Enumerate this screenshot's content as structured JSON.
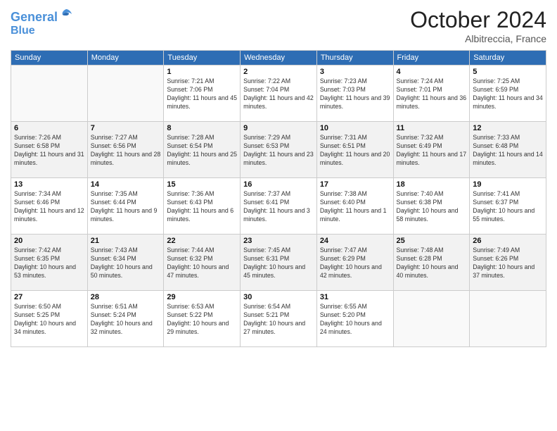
{
  "header": {
    "logo_line1": "General",
    "logo_line2": "Blue",
    "month": "October 2024",
    "location": "Albitreccia, France"
  },
  "weekdays": [
    "Sunday",
    "Monday",
    "Tuesday",
    "Wednesday",
    "Thursday",
    "Friday",
    "Saturday"
  ],
  "weeks": [
    [
      {
        "day": "",
        "info": ""
      },
      {
        "day": "",
        "info": ""
      },
      {
        "day": "1",
        "info": "Sunrise: 7:21 AM\nSunset: 7:06 PM\nDaylight: 11 hours and 45 minutes."
      },
      {
        "day": "2",
        "info": "Sunrise: 7:22 AM\nSunset: 7:04 PM\nDaylight: 11 hours and 42 minutes."
      },
      {
        "day": "3",
        "info": "Sunrise: 7:23 AM\nSunset: 7:03 PM\nDaylight: 11 hours and 39 minutes."
      },
      {
        "day": "4",
        "info": "Sunrise: 7:24 AM\nSunset: 7:01 PM\nDaylight: 11 hours and 36 minutes."
      },
      {
        "day": "5",
        "info": "Sunrise: 7:25 AM\nSunset: 6:59 PM\nDaylight: 11 hours and 34 minutes."
      }
    ],
    [
      {
        "day": "6",
        "info": "Sunrise: 7:26 AM\nSunset: 6:58 PM\nDaylight: 11 hours and 31 minutes."
      },
      {
        "day": "7",
        "info": "Sunrise: 7:27 AM\nSunset: 6:56 PM\nDaylight: 11 hours and 28 minutes."
      },
      {
        "day": "8",
        "info": "Sunrise: 7:28 AM\nSunset: 6:54 PM\nDaylight: 11 hours and 25 minutes."
      },
      {
        "day": "9",
        "info": "Sunrise: 7:29 AM\nSunset: 6:53 PM\nDaylight: 11 hours and 23 minutes."
      },
      {
        "day": "10",
        "info": "Sunrise: 7:31 AM\nSunset: 6:51 PM\nDaylight: 11 hours and 20 minutes."
      },
      {
        "day": "11",
        "info": "Sunrise: 7:32 AM\nSunset: 6:49 PM\nDaylight: 11 hours and 17 minutes."
      },
      {
        "day": "12",
        "info": "Sunrise: 7:33 AM\nSunset: 6:48 PM\nDaylight: 11 hours and 14 minutes."
      }
    ],
    [
      {
        "day": "13",
        "info": "Sunrise: 7:34 AM\nSunset: 6:46 PM\nDaylight: 11 hours and 12 minutes."
      },
      {
        "day": "14",
        "info": "Sunrise: 7:35 AM\nSunset: 6:44 PM\nDaylight: 11 hours and 9 minutes."
      },
      {
        "day": "15",
        "info": "Sunrise: 7:36 AM\nSunset: 6:43 PM\nDaylight: 11 hours and 6 minutes."
      },
      {
        "day": "16",
        "info": "Sunrise: 7:37 AM\nSunset: 6:41 PM\nDaylight: 11 hours and 3 minutes."
      },
      {
        "day": "17",
        "info": "Sunrise: 7:38 AM\nSunset: 6:40 PM\nDaylight: 11 hours and 1 minute."
      },
      {
        "day": "18",
        "info": "Sunrise: 7:40 AM\nSunset: 6:38 PM\nDaylight: 10 hours and 58 minutes."
      },
      {
        "day": "19",
        "info": "Sunrise: 7:41 AM\nSunset: 6:37 PM\nDaylight: 10 hours and 55 minutes."
      }
    ],
    [
      {
        "day": "20",
        "info": "Sunrise: 7:42 AM\nSunset: 6:35 PM\nDaylight: 10 hours and 53 minutes."
      },
      {
        "day": "21",
        "info": "Sunrise: 7:43 AM\nSunset: 6:34 PM\nDaylight: 10 hours and 50 minutes."
      },
      {
        "day": "22",
        "info": "Sunrise: 7:44 AM\nSunset: 6:32 PM\nDaylight: 10 hours and 47 minutes."
      },
      {
        "day": "23",
        "info": "Sunrise: 7:45 AM\nSunset: 6:31 PM\nDaylight: 10 hours and 45 minutes."
      },
      {
        "day": "24",
        "info": "Sunrise: 7:47 AM\nSunset: 6:29 PM\nDaylight: 10 hours and 42 minutes."
      },
      {
        "day": "25",
        "info": "Sunrise: 7:48 AM\nSunset: 6:28 PM\nDaylight: 10 hours and 40 minutes."
      },
      {
        "day": "26",
        "info": "Sunrise: 7:49 AM\nSunset: 6:26 PM\nDaylight: 10 hours and 37 minutes."
      }
    ],
    [
      {
        "day": "27",
        "info": "Sunrise: 6:50 AM\nSunset: 5:25 PM\nDaylight: 10 hours and 34 minutes."
      },
      {
        "day": "28",
        "info": "Sunrise: 6:51 AM\nSunset: 5:24 PM\nDaylight: 10 hours and 32 minutes."
      },
      {
        "day": "29",
        "info": "Sunrise: 6:53 AM\nSunset: 5:22 PM\nDaylight: 10 hours and 29 minutes."
      },
      {
        "day": "30",
        "info": "Sunrise: 6:54 AM\nSunset: 5:21 PM\nDaylight: 10 hours and 27 minutes."
      },
      {
        "day": "31",
        "info": "Sunrise: 6:55 AM\nSunset: 5:20 PM\nDaylight: 10 hours and 24 minutes."
      },
      {
        "day": "",
        "info": ""
      },
      {
        "day": "",
        "info": ""
      }
    ]
  ]
}
